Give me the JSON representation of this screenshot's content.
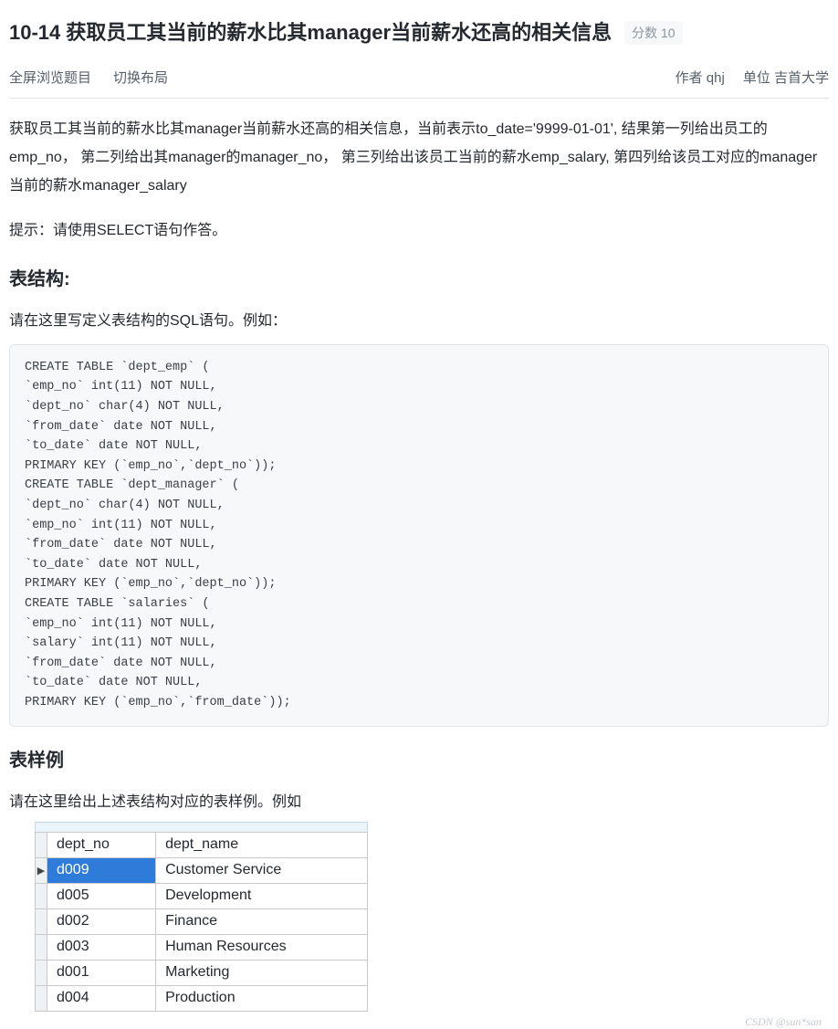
{
  "header": {
    "title": "10-14 获取员工其当前的薪水比其manager当前薪水还高的相关信息",
    "score_label": "分数 10"
  },
  "meta": {
    "fullscreen": "全屏浏览题目",
    "toggle_layout": "切换布局",
    "author_label": "作者 qhj",
    "org_label": "单位 吉首大学"
  },
  "body": {
    "intro": "获取员工其当前的薪水比其manager当前薪水还高的相关信息，当前表示to_date='9999-01-01', 结果第一列给出员工的emp_no， 第二列给出其manager的manager_no， 第三列给出该员工当前的薪水emp_salary, 第四列给该员工对应的manager当前的薪水manager_salary",
    "hint": "提示：请使用SELECT语句作答。",
    "h_struct": "表结构:",
    "struct_intro": "请在这里写定义表结构的SQL语句。例如：",
    "sql": "CREATE TABLE `dept_emp` (\n`emp_no` int(11) NOT NULL,\n`dept_no` char(4) NOT NULL,\n`from_date` date NOT NULL,\n`to_date` date NOT NULL,\nPRIMARY KEY (`emp_no`,`dept_no`));\nCREATE TABLE `dept_manager` (\n`dept_no` char(4) NOT NULL,\n`emp_no` int(11) NOT NULL,\n`from_date` date NOT NULL,\n`to_date` date NOT NULL,\nPRIMARY KEY (`emp_no`,`dept_no`));\nCREATE TABLE `salaries` (\n`emp_no` int(11) NOT NULL,\n`salary` int(11) NOT NULL,\n`from_date` date NOT NULL,\n`to_date` date NOT NULL,\nPRIMARY KEY (`emp_no`,`from_date`));",
    "h_sample": "表样例",
    "sample_intro": "请在这里给出上述表结构对应的表样例。例如"
  },
  "sample_table": {
    "headers": [
      "dept_no",
      "dept_name"
    ],
    "rows": [
      {
        "dept_no": "d009",
        "dept_name": "Customer Service",
        "selected": true
      },
      {
        "dept_no": "d005",
        "dept_name": "Development",
        "selected": false
      },
      {
        "dept_no": "d002",
        "dept_name": "Finance",
        "selected": false
      },
      {
        "dept_no": "d003",
        "dept_name": "Human Resources",
        "selected": false
      },
      {
        "dept_no": "d001",
        "dept_name": "Marketing",
        "selected": false
      },
      {
        "dept_no": "d004",
        "dept_name": "Production",
        "selected": false
      }
    ]
  },
  "watermark": "CSDN @sun*san"
}
